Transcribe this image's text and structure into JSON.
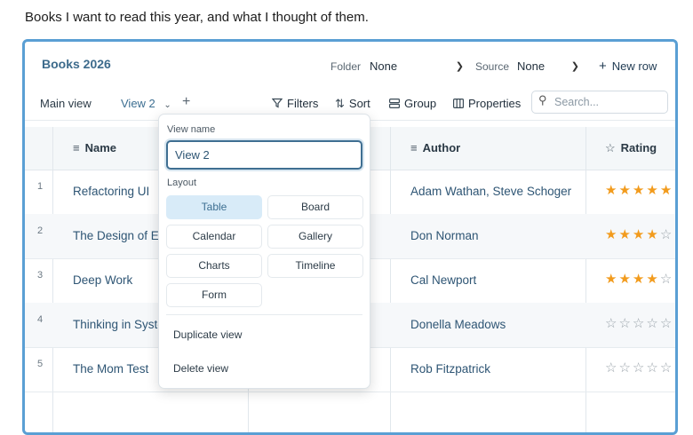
{
  "intro_text": "Books I want to read this year, and what I thought of them.",
  "database": {
    "title": "Books 2026",
    "folder_label": "Folder",
    "folder_value": "None",
    "source_label": "Source",
    "source_value": "None",
    "new_row_label": "New row"
  },
  "toolbar": {
    "tabs": [
      "Main view",
      "View 2"
    ],
    "filters_label": "Filters",
    "sort_label": "Sort",
    "group_label": "Group",
    "properties_label": "Properties",
    "search_placeholder": "Search..."
  },
  "columns": {
    "name": "Name",
    "author": "Author",
    "rating": "Rating"
  },
  "rows": [
    {
      "num": "1",
      "name": "Refactoring UI",
      "author": "Adam Wathan, Steve Schoger",
      "rating": 5
    },
    {
      "num": "2",
      "name": "The Design of Everyday Things",
      "author": "Don Norman",
      "rating": 4
    },
    {
      "num": "3",
      "name": "Deep Work",
      "author": "Cal Newport",
      "rating": 4
    },
    {
      "num": "4",
      "name": "Thinking in Systems",
      "author": "Donella Meadows",
      "rating": 0
    },
    {
      "num": "5",
      "name": "The Mom Test",
      "author": "Rob Fitzpatrick",
      "rating": 0
    }
  ],
  "view_popup": {
    "view_name_label": "View name",
    "view_name_value": "View 2",
    "layout_label": "Layout",
    "layouts": [
      "Table",
      "Board",
      "Calendar",
      "Gallery",
      "Charts",
      "Timeline",
      "Form"
    ],
    "selected_layout": "Table",
    "duplicate_label": "Duplicate view",
    "delete_label": "Delete view"
  },
  "colors": {
    "accent": "#3d6f92",
    "frame_border": "#5a9fd4",
    "star_filled": "#f29b1d",
    "selected_layout_bg": "#d8ebf8"
  }
}
